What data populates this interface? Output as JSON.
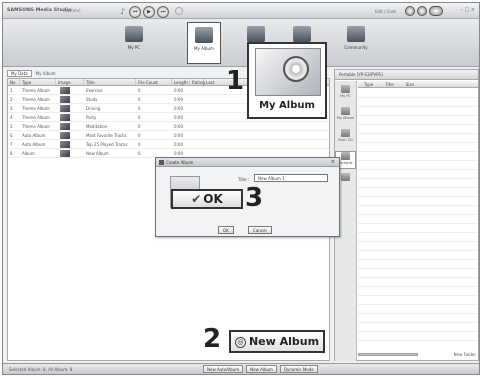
{
  "titlebar": {
    "brand": "SAMSUNG Media Studio",
    "subtitle": "(Update)",
    "user": "Edit / Cnet"
  },
  "nav": {
    "items": [
      {
        "label": "My PC"
      },
      {
        "label": "My Album"
      },
      {
        "label": ""
      },
      {
        "label": ""
      },
      {
        "label": "Community"
      }
    ]
  },
  "left": {
    "tab": "My Data",
    "path": "My Album",
    "columns": [
      "No",
      "Type",
      "Image",
      "Title",
      "File Count",
      "Length",
      "Rating",
      "Last"
    ],
    "rows": [
      {
        "no": "1",
        "type": "Theme Album",
        "title": "Exercise",
        "count": "0",
        "len": "0:00"
      },
      {
        "no": "2",
        "type": "Theme Album",
        "title": "Study",
        "count": "0",
        "len": "0:00"
      },
      {
        "no": "3",
        "type": "Theme Album",
        "title": "Driving",
        "count": "0",
        "len": "0:00"
      },
      {
        "no": "4",
        "type": "Theme Album",
        "title": "Party",
        "count": "0",
        "len": "0:00"
      },
      {
        "no": "5",
        "type": "Theme Album",
        "title": "Meditation",
        "count": "0",
        "len": "0:00"
      },
      {
        "no": "6",
        "type": "Auto Album",
        "title": "Most Favorite Tracks",
        "count": "0",
        "len": "0:00"
      },
      {
        "no": "7",
        "type": "Auto Album",
        "title": "Top 25 Played Tracks",
        "count": "0",
        "len": "0:00"
      },
      {
        "no": "8",
        "type": "Album",
        "title": "New Album",
        "count": "0",
        "len": "0:00"
      }
    ]
  },
  "right": {
    "header": "Portable [YP-S3/PVPS]",
    "cols": [
      "Type",
      "Title",
      "Size"
    ],
    "sidetabs": [
      "My PC",
      "My Album",
      "Burn CD",
      "Portable",
      ""
    ],
    "footer_left": "",
    "footer_right": "New Folder"
  },
  "dialog": {
    "title": "Create Album",
    "field_label": "Title :",
    "field_value": "New Album 1",
    "ok": "OK",
    "cancel": "Cancel"
  },
  "callouts": {
    "num1": "1",
    "num2": "2",
    "num3": "3",
    "album_label": "My Album",
    "ok_label": "OK",
    "new_album_label": "New Album"
  },
  "bottombar": {
    "status": "Selected Album: 8, All Album: 8",
    "buttons": [
      "New AutoAlbum",
      "New Album",
      "Dynamic Mode"
    ]
  }
}
